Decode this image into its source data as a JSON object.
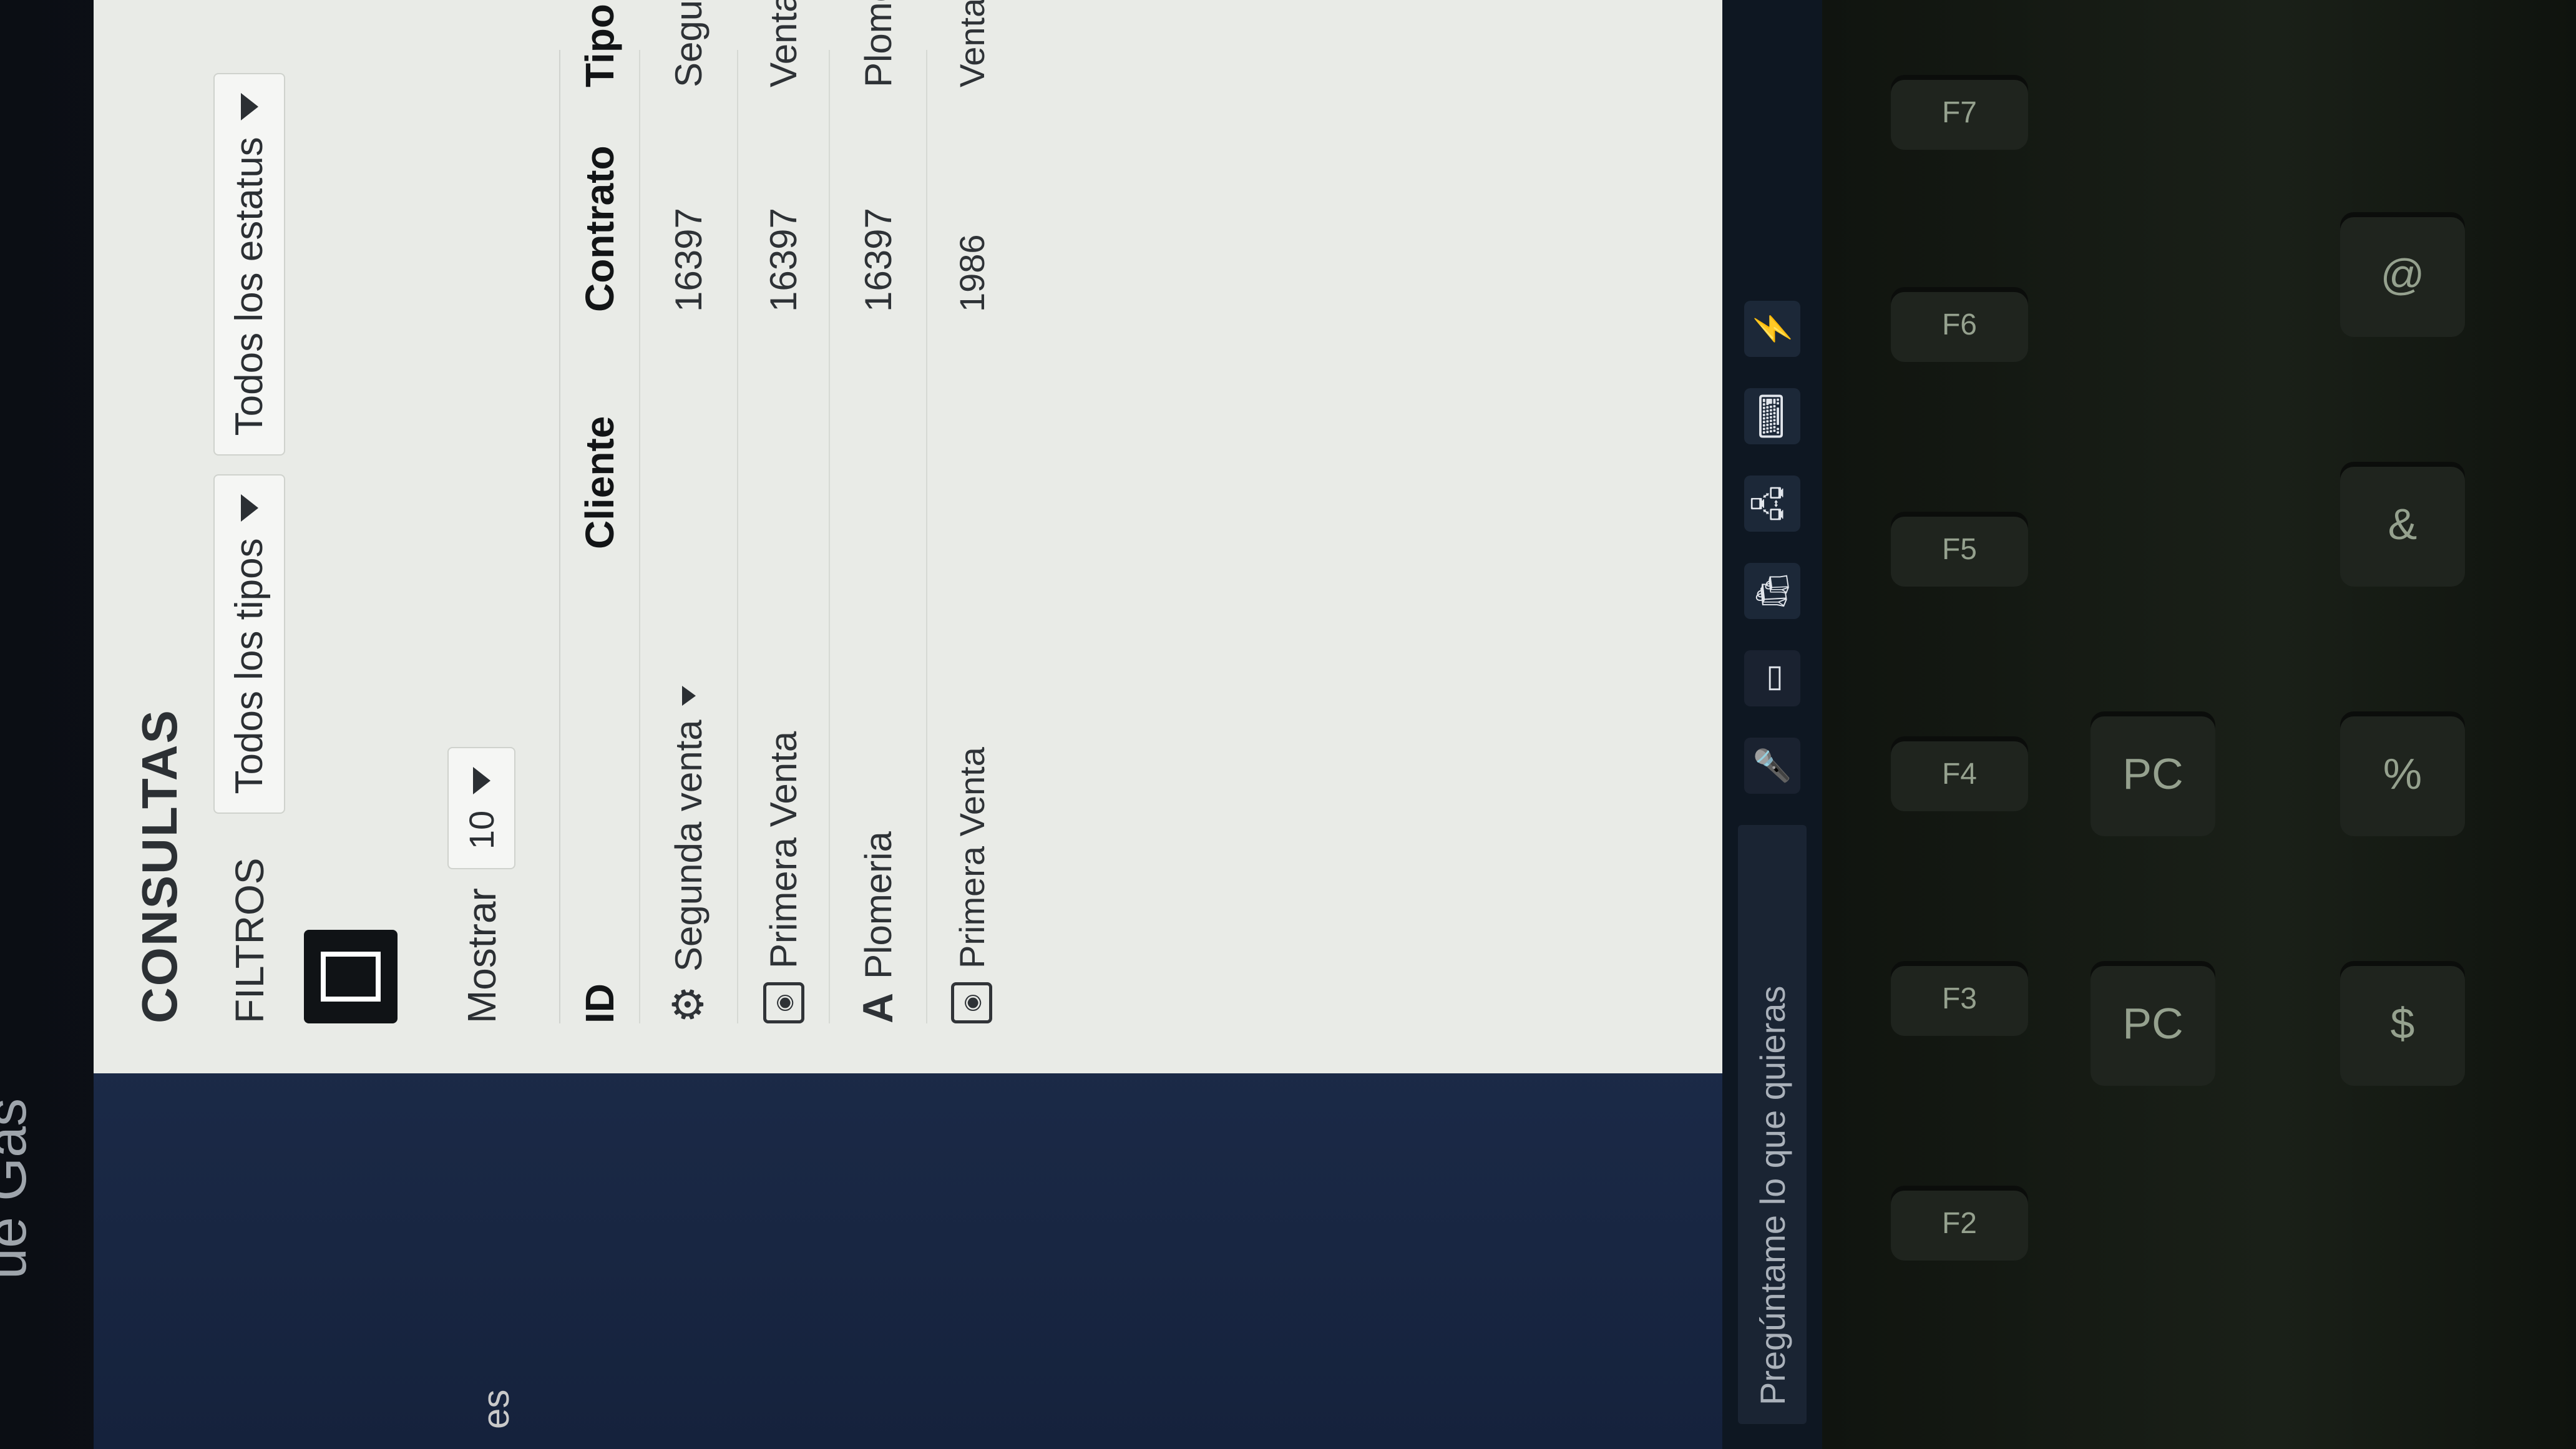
{
  "app": {
    "title": "CONSULTAS",
    "filters": {
      "label": "FILTROS",
      "type_select": "Todos los tipos",
      "status_select": "Todos los estatus",
      "excel_icon": "excel-export-icon"
    },
    "show": {
      "label": "Mostrar",
      "value": "10"
    },
    "table": {
      "headers": {
        "id": "ID",
        "cliente": "Cliente",
        "contrato": "Contrato",
        "tipo": "Tipo"
      },
      "rows": [
        {
          "label": "Segunda venta",
          "icon": "gear-icon",
          "contrato": "16397",
          "tipo": "Segunda Venta"
        },
        {
          "label": "Primera Venta",
          "icon": "id-card-icon",
          "contrato": "16397",
          "tipo": "Venta"
        },
        {
          "label": "Plomeria",
          "icon": "letter-a-icon",
          "contrato": "16397",
          "tipo": "Plomero"
        },
        {
          "label": "Primera Venta",
          "icon": "id-card-icon",
          "contrato": "1986",
          "tipo": "Venta"
        }
      ]
    }
  },
  "taskbar": {
    "search_placeholder": "Pregúntame lo que quieras"
  },
  "desktop": {
    "partial_text": "ue Gas",
    "side_label": "es"
  },
  "keyboard": {
    "keys": [
      "F2",
      "F3",
      "F4",
      "F5",
      "F6",
      "F7",
      "PC",
      "PC",
      "$",
      "%",
      "&",
      "@"
    ]
  }
}
